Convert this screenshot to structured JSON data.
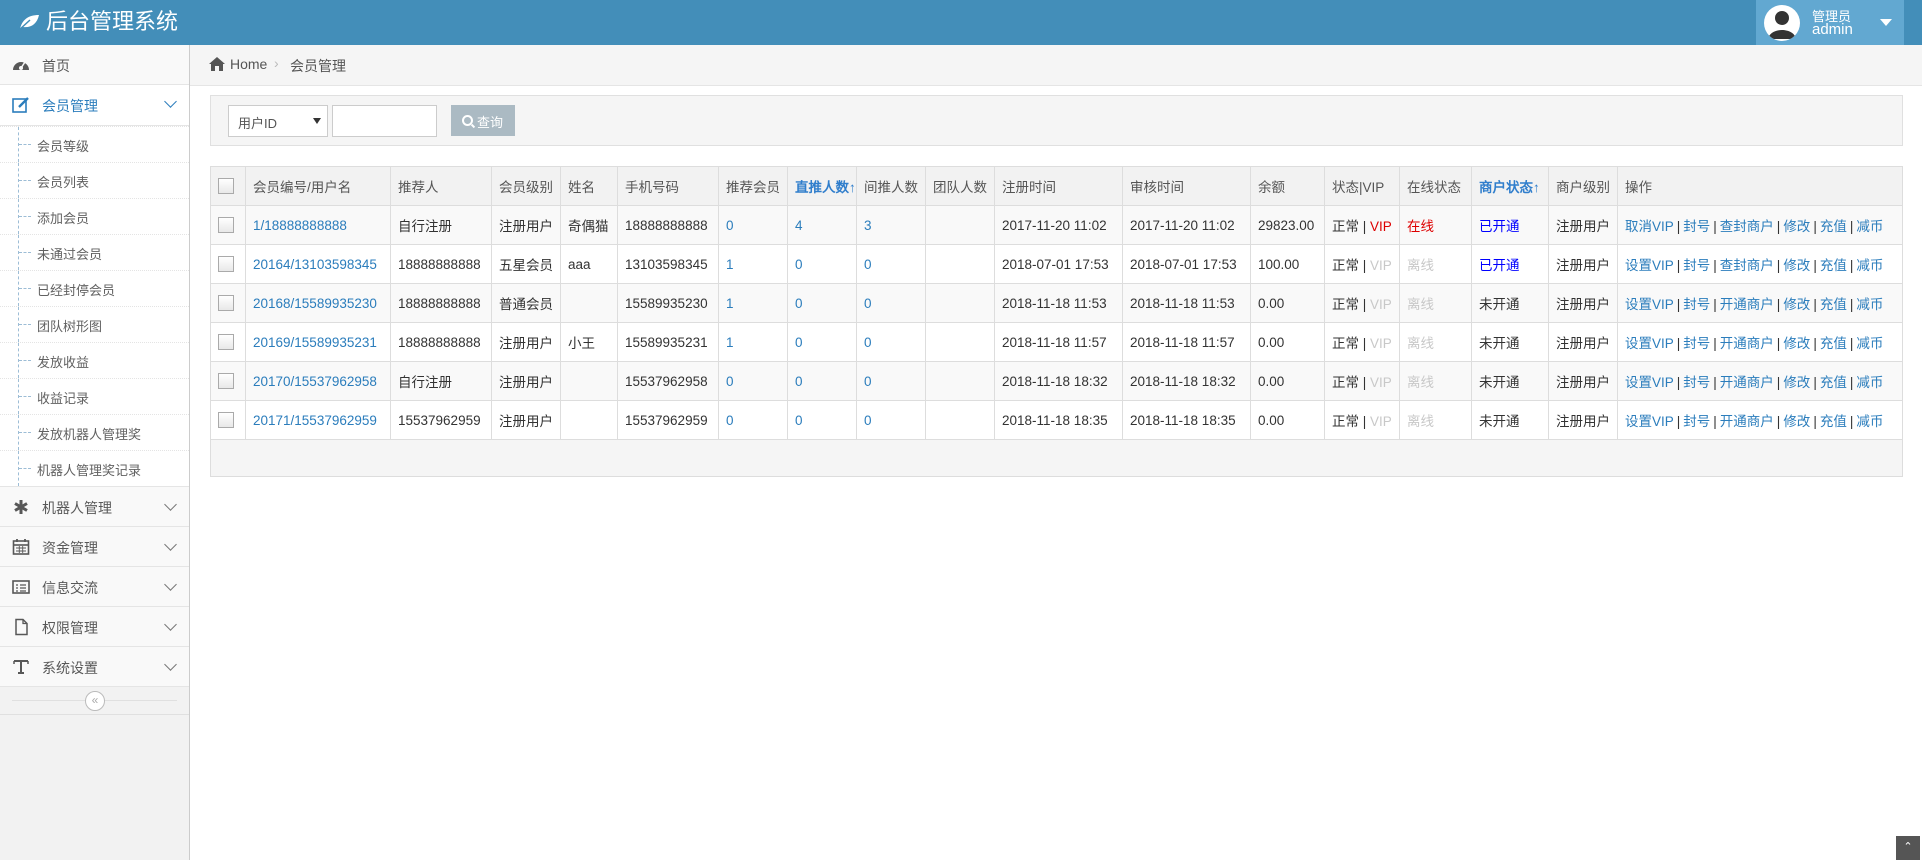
{
  "app": {
    "title": "后台管理系统"
  },
  "user": {
    "role": "管理员",
    "name": "admin"
  },
  "sidebar": {
    "items": [
      {
        "label": "首页",
        "icon": "dashboard-icon"
      },
      {
        "label": "会员管理",
        "icon": "edit-icon",
        "open": true
      },
      {
        "label": "机器人管理",
        "icon": "asterisk-icon"
      },
      {
        "label": "资金管理",
        "icon": "calendar-icon"
      },
      {
        "label": "信息交流",
        "icon": "list-icon"
      },
      {
        "label": "权限管理",
        "icon": "file-icon"
      },
      {
        "label": "系统设置",
        "icon": "text-icon"
      }
    ],
    "sub_items": [
      "会员等级",
      "会员列表",
      "添加会员",
      "未通过会员",
      "已经封停会员",
      "团队树形图",
      "发放收益",
      "收益记录",
      "发放机器人管理奖",
      "机器人管理奖记录"
    ],
    "collapse_glyph": "«"
  },
  "breadcrumb": {
    "home": "Home",
    "separator": "›",
    "current": "会员管理"
  },
  "search": {
    "select_value": "用户ID",
    "input_value": "",
    "button_label": "查询"
  },
  "table": {
    "headers": [
      "会员编号/用户名",
      "推荐人",
      "会员级别",
      "姓名",
      "手机号码",
      "推荐会员",
      "直推人数↑",
      "间推人数",
      "团队人数",
      "注册时间",
      "审核时间",
      "余额",
      "状态|VIP",
      "在线状态",
      "商户状态↑",
      "商户级别",
      "操作"
    ],
    "rows": [
      [
        "1/18888888888",
        "自行注册",
        "注册用户",
        "奇偶猫",
        "18888888888",
        "0",
        "4",
        "3",
        "",
        "2017-11-20 11:02",
        "2017-11-20 11:02",
        "29823.00",
        "正常",
        "VIP",
        "在线",
        "已开通",
        "注册用户",
        "取消VIP",
        "查封商户"
      ],
      [
        "20164/13103598345",
        "18888888888",
        "五星会员",
        "aaa",
        "13103598345",
        "1",
        "0",
        "0",
        "",
        "2018-07-01 17:53",
        "2018-07-01 17:53",
        "100.00",
        "正常",
        "VIP",
        "离线",
        "已开通",
        "注册用户",
        "设置VIP",
        "查封商户"
      ],
      [
        "20168/15589935230",
        "18888888888",
        "普通会员",
        "",
        "15589935230",
        "1",
        "0",
        "0",
        "",
        "2018-11-18 11:53",
        "2018-11-18 11:53",
        "0.00",
        "正常",
        "VIP",
        "离线",
        "未开通",
        "注册用户",
        "设置VIP",
        "开通商户"
      ],
      [
        "20169/15589935231",
        "18888888888",
        "注册用户",
        "小王",
        "15589935231",
        "1",
        "0",
        "0",
        "",
        "2018-11-18 11:57",
        "2018-11-18 11:57",
        "0.00",
        "正常",
        "VIP",
        "离线",
        "未开通",
        "注册用户",
        "设置VIP",
        "开通商户"
      ],
      [
        "20170/15537962958",
        "自行注册",
        "注册用户",
        "",
        "15537962958",
        "0",
        "0",
        "0",
        "",
        "2018-11-18 18:32",
        "2018-11-18 18:32",
        "0.00",
        "正常",
        "VIP",
        "离线",
        "未开通",
        "注册用户",
        "设置VIP",
        "开通商户"
      ],
      [
        "20171/15537962959",
        "15537962959",
        "注册用户",
        "",
        "15537962959",
        "0",
        "0",
        "0",
        "",
        "2018-11-18 18:35",
        "2018-11-18 18:35",
        "0.00",
        "正常",
        "VIP",
        "离线",
        "未开通",
        "注册用户",
        "设置VIP",
        "开通商户"
      ]
    ],
    "status_sep": " | ",
    "action_sep": "|",
    "actions": {
      "ban": "封号",
      "edit": "修改",
      "recharge": "充值",
      "deduct": "减币"
    }
  },
  "colors": {
    "header_bg": "#438eb9",
    "link": "#2b7dbc",
    "vip_active": "#dd0000",
    "merchant_open": "#0000ff",
    "inactive": "#c8c8c8"
  },
  "scroll_top_glyph": "⌃"
}
